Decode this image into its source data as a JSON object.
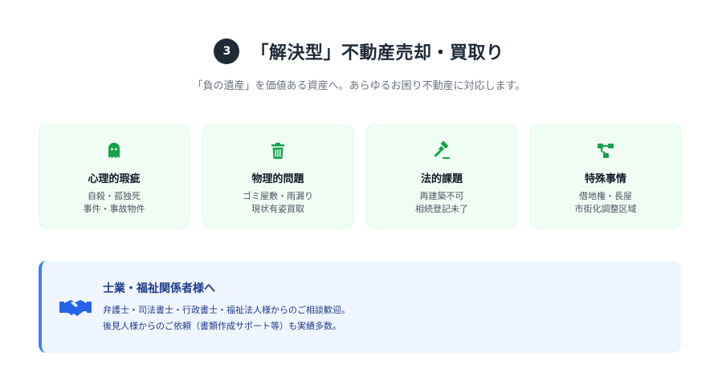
{
  "section": {
    "step_number": "3",
    "title": "「解決型」不動産売却・買取り",
    "subtitle": "「負の遺産」を価値ある資産へ。あらゆるお困り不動産に対応します。"
  },
  "cards": [
    {
      "icon": "ghost-icon",
      "title": "心理的瑕疵",
      "lines": [
        "自殺・孤独死",
        "事件・事故物件"
      ]
    },
    {
      "icon": "trash-icon",
      "title": "物理的問題",
      "lines": [
        "ゴミ屋敷・雨漏り",
        "現状有姿買取"
      ]
    },
    {
      "icon": "gavel-icon",
      "title": "法的課題",
      "lines": [
        "再建築不可",
        "相続登記未了"
      ]
    },
    {
      "icon": "network-icon",
      "title": "特殊事情",
      "lines": [
        "借地権・長屋",
        "市街化調整区域"
      ]
    }
  ],
  "notice": {
    "icon": "handshake-icon",
    "title": "士業・福祉関係者様へ",
    "line1": "弁護士・司法書士・行政書士・福祉法人様からのご相談歓迎。",
    "line2": "後見人様からのご依頼（書類作成サポート等）も実績多数。"
  },
  "colors": {
    "accent_green": "#16a34a",
    "card_bg": "#f0fdf4",
    "notice_bg": "#eff6ff",
    "notice_border": "#3b82f6",
    "badge_bg": "#1f2937"
  }
}
